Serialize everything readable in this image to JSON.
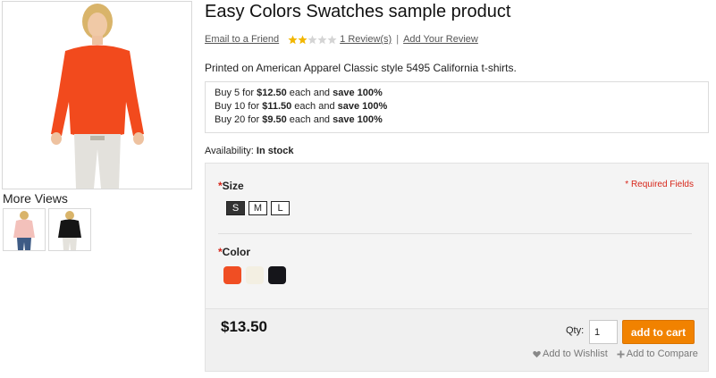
{
  "gallery": {
    "main_image_icon": "model-orange-sweater",
    "more_views_title": "More Views",
    "thumbnails": [
      "model-pink-sweater",
      "model-black-sweater"
    ]
  },
  "product": {
    "name": "Easy Colors Swatches sample product",
    "email_link": "Email to a Friend",
    "rating": {
      "stars_filled": 2,
      "stars_total": 5
    },
    "reviews_link": "1 Review(s)",
    "separator": "|",
    "add_review_link": "Add Your Review",
    "short_description": "Printed on American Apparel Classic style 5495 California t-shirts.",
    "tier_prices": [
      {
        "prefix": "Buy 5 for ",
        "price": "$12.50",
        "middle": " each and ",
        "save": "save 100%"
      },
      {
        "prefix": "Buy 10 for ",
        "price": "$11.50",
        "middle": " each and ",
        "save": "save 100%"
      },
      {
        "prefix": "Buy 20 for ",
        "price": "$9.50",
        "middle": " each and ",
        "save": "save 100%"
      }
    ],
    "availability_label": "Availability:",
    "availability_value": "In stock"
  },
  "options": {
    "required_fields_text": "* Required Fields",
    "size": {
      "asterisk": "*",
      "label": "Size",
      "values": [
        "S",
        "M",
        "L"
      ],
      "selected_index": 0
    },
    "color": {
      "asterisk": "*",
      "label": "Color",
      "swatches": [
        {
          "name": "orange",
          "hex": "#f04e23"
        },
        {
          "name": "cream",
          "hex": "#f3efe2"
        },
        {
          "name": "black",
          "hex": "#15151a"
        }
      ]
    }
  },
  "buy": {
    "price": "$13.50",
    "qty_label": "Qty:",
    "qty_value": "1",
    "add_to_cart_label": "add to cart",
    "wishlist_label": "Add to Wishlist",
    "compare_label": "Add to Compare"
  },
  "colors": {
    "accent": "#f18200",
    "required": "#d7261a",
    "star": "#f2b600"
  }
}
